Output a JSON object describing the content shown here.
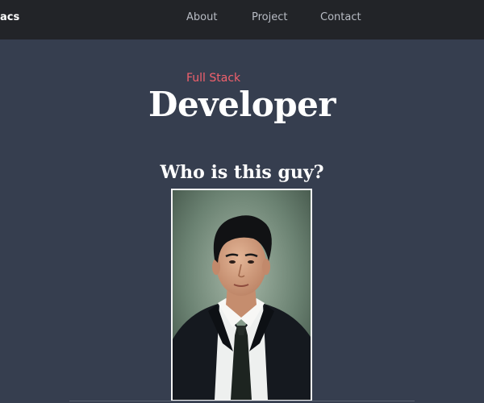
{
  "nav": {
    "brand": "acs",
    "links": [
      {
        "label": "About"
      },
      {
        "label": "Project"
      },
      {
        "label": "Contact"
      }
    ]
  },
  "hero": {
    "subtitle": "Full Stack",
    "title": "Developer"
  },
  "about": {
    "question": "Who is this guy?"
  },
  "colors": {
    "navbar_bg": "#222428",
    "page_bg": "#363e4f",
    "accent": "#f2616d",
    "nav_link": "#b8bcc4",
    "text": "#ffffff"
  }
}
